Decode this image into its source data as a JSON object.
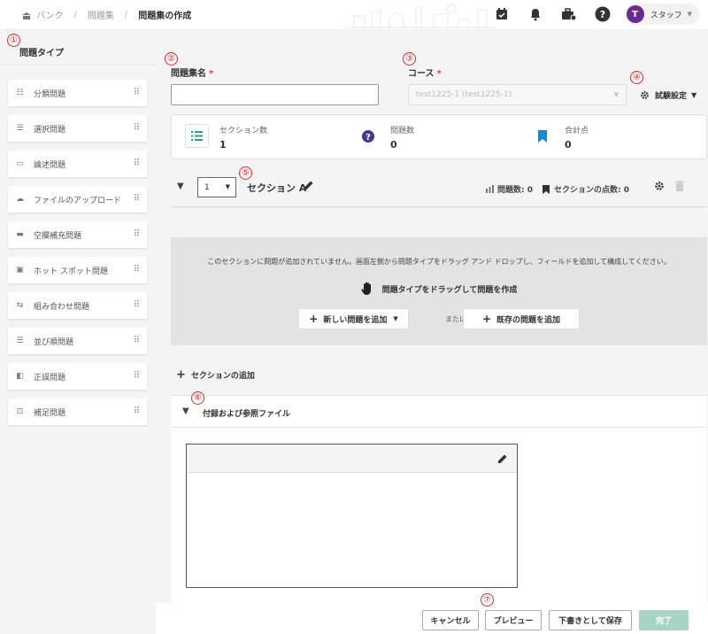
{
  "breadcrumb": {
    "home": "バンク",
    "level2": "問題集",
    "current": "問題集の作成"
  },
  "user": {
    "initial": "T",
    "name": "スタッフ"
  },
  "sidebar": {
    "title": "問題タイプ",
    "items": [
      {
        "label": "分類問題",
        "icon": "list-box-icon"
      },
      {
        "label": "選択問題",
        "icon": "choice-list-icon"
      },
      {
        "label": "論述問題",
        "icon": "essay-icon"
      },
      {
        "label": "ファイルのアップロード",
        "icon": "cloud-upload-icon"
      },
      {
        "label": "空欄補充問題",
        "icon": "blank-fill-icon"
      },
      {
        "label": "ホット スポット問題",
        "icon": "image-icon"
      },
      {
        "label": "組み合わせ問題",
        "icon": "matching-icon"
      },
      {
        "label": "並び順問題",
        "icon": "ordering-icon"
      },
      {
        "label": "正誤問題",
        "icon": "true-false-icon"
      },
      {
        "label": "補足問題",
        "icon": "supplement-icon"
      }
    ]
  },
  "form": {
    "name_label": "問題集名",
    "name_value": "",
    "course_label": "コース",
    "required_mark": "*",
    "course_value": "test1225-1 (test1225-1)",
    "exam_setting_label": "試験設定"
  },
  "stats": [
    {
      "label": "セクション数",
      "value": "1",
      "icon": "list-icon",
      "color": "#2a9d8f"
    },
    {
      "label": "問題数",
      "value": "0",
      "icon": "question-circle-icon",
      "color": "#3f3d8f"
    },
    {
      "label": "合計点",
      "value": "0",
      "icon": "bookmark-icon",
      "color": "#1e88c8"
    }
  ],
  "section": {
    "number": "1",
    "title": "セクション A",
    "question_count_label": "問題数: 0",
    "points_label": "セクションの点数: 0"
  },
  "dropzone": {
    "message": "このセクションに問題が追加されていません。画面左側から問題タイプをドラッグ アンド ドロップし、フィールドを追加して構成してください。",
    "drag_hint": "問題タイプをドラッグして問題を作成",
    "new_question_label": "新しい問題を追加",
    "or_label": "または",
    "existing_question_label": "既存の問題を追加"
  },
  "add_section_label": "セクションの追加",
  "attachments": {
    "title": "付録および参照ファイル"
  },
  "footer": {
    "cancel": "キャンセル",
    "preview": "プレビュー",
    "save_draft": "下書きとして保存",
    "done": "完了"
  },
  "markers": [
    "①",
    "②",
    "③",
    "④",
    "⑤",
    "⑥",
    "⑦"
  ],
  "colors": {
    "accent": "#6a2c91",
    "required": "#e53935",
    "marker": "#d32f2f",
    "done_button": "#a8d5c2"
  }
}
